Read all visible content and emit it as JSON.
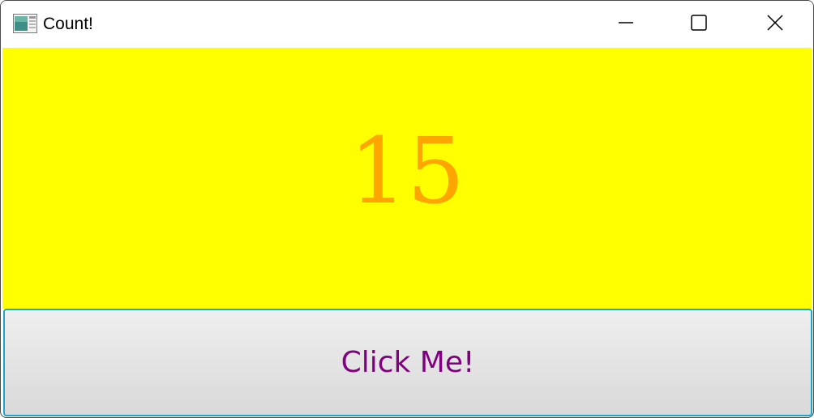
{
  "window": {
    "title": "Count!",
    "icon": "app-window-icon",
    "controls": {
      "minimize_icon": "minimize-icon",
      "maximize_icon": "maximize-icon",
      "close_icon": "close-icon"
    }
  },
  "counter": {
    "value": "15",
    "background_color": "#ffff00",
    "text_color": "#ffa500"
  },
  "button": {
    "label": "Click Me!",
    "label_color": "#800080",
    "border_color": "#1fa3c9"
  }
}
